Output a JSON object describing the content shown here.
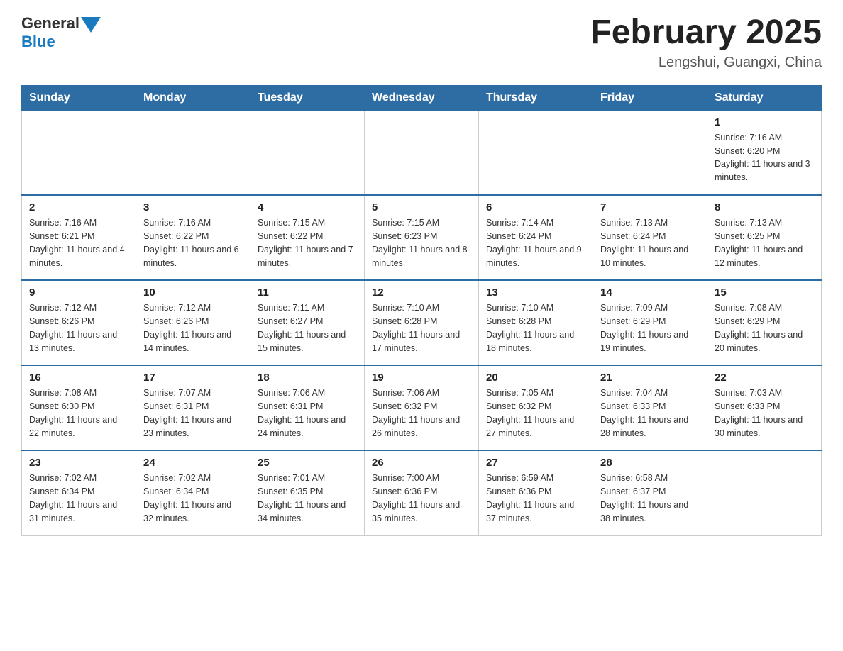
{
  "header": {
    "logo_general": "General",
    "logo_blue": "Blue",
    "title": "February 2025",
    "subtitle": "Lengshui, Guangxi, China"
  },
  "days_of_week": [
    "Sunday",
    "Monday",
    "Tuesday",
    "Wednesday",
    "Thursday",
    "Friday",
    "Saturday"
  ],
  "weeks": [
    {
      "days": [
        {
          "number": "",
          "info": ""
        },
        {
          "number": "",
          "info": ""
        },
        {
          "number": "",
          "info": ""
        },
        {
          "number": "",
          "info": ""
        },
        {
          "number": "",
          "info": ""
        },
        {
          "number": "",
          "info": ""
        },
        {
          "number": "1",
          "info": "Sunrise: 7:16 AM\nSunset: 6:20 PM\nDaylight: 11 hours\nand 3 minutes."
        }
      ]
    },
    {
      "days": [
        {
          "number": "2",
          "info": "Sunrise: 7:16 AM\nSunset: 6:21 PM\nDaylight: 11 hours\nand 4 minutes."
        },
        {
          "number": "3",
          "info": "Sunrise: 7:16 AM\nSunset: 6:22 PM\nDaylight: 11 hours\nand 6 minutes."
        },
        {
          "number": "4",
          "info": "Sunrise: 7:15 AM\nSunset: 6:22 PM\nDaylight: 11 hours\nand 7 minutes."
        },
        {
          "number": "5",
          "info": "Sunrise: 7:15 AM\nSunset: 6:23 PM\nDaylight: 11 hours\nand 8 minutes."
        },
        {
          "number": "6",
          "info": "Sunrise: 7:14 AM\nSunset: 6:24 PM\nDaylight: 11 hours\nand 9 minutes."
        },
        {
          "number": "7",
          "info": "Sunrise: 7:13 AM\nSunset: 6:24 PM\nDaylight: 11 hours\nand 10 minutes."
        },
        {
          "number": "8",
          "info": "Sunrise: 7:13 AM\nSunset: 6:25 PM\nDaylight: 11 hours\nand 12 minutes."
        }
      ]
    },
    {
      "days": [
        {
          "number": "9",
          "info": "Sunrise: 7:12 AM\nSunset: 6:26 PM\nDaylight: 11 hours\nand 13 minutes."
        },
        {
          "number": "10",
          "info": "Sunrise: 7:12 AM\nSunset: 6:26 PM\nDaylight: 11 hours\nand 14 minutes."
        },
        {
          "number": "11",
          "info": "Sunrise: 7:11 AM\nSunset: 6:27 PM\nDaylight: 11 hours\nand 15 minutes."
        },
        {
          "number": "12",
          "info": "Sunrise: 7:10 AM\nSunset: 6:28 PM\nDaylight: 11 hours\nand 17 minutes."
        },
        {
          "number": "13",
          "info": "Sunrise: 7:10 AM\nSunset: 6:28 PM\nDaylight: 11 hours\nand 18 minutes."
        },
        {
          "number": "14",
          "info": "Sunrise: 7:09 AM\nSunset: 6:29 PM\nDaylight: 11 hours\nand 19 minutes."
        },
        {
          "number": "15",
          "info": "Sunrise: 7:08 AM\nSunset: 6:29 PM\nDaylight: 11 hours\nand 20 minutes."
        }
      ]
    },
    {
      "days": [
        {
          "number": "16",
          "info": "Sunrise: 7:08 AM\nSunset: 6:30 PM\nDaylight: 11 hours\nand 22 minutes."
        },
        {
          "number": "17",
          "info": "Sunrise: 7:07 AM\nSunset: 6:31 PM\nDaylight: 11 hours\nand 23 minutes."
        },
        {
          "number": "18",
          "info": "Sunrise: 7:06 AM\nSunset: 6:31 PM\nDaylight: 11 hours\nand 24 minutes."
        },
        {
          "number": "19",
          "info": "Sunrise: 7:06 AM\nSunset: 6:32 PM\nDaylight: 11 hours\nand 26 minutes."
        },
        {
          "number": "20",
          "info": "Sunrise: 7:05 AM\nSunset: 6:32 PM\nDaylight: 11 hours\nand 27 minutes."
        },
        {
          "number": "21",
          "info": "Sunrise: 7:04 AM\nSunset: 6:33 PM\nDaylight: 11 hours\nand 28 minutes."
        },
        {
          "number": "22",
          "info": "Sunrise: 7:03 AM\nSunset: 6:33 PM\nDaylight: 11 hours\nand 30 minutes."
        }
      ]
    },
    {
      "days": [
        {
          "number": "23",
          "info": "Sunrise: 7:02 AM\nSunset: 6:34 PM\nDaylight: 11 hours\nand 31 minutes."
        },
        {
          "number": "24",
          "info": "Sunrise: 7:02 AM\nSunset: 6:34 PM\nDaylight: 11 hours\nand 32 minutes."
        },
        {
          "number": "25",
          "info": "Sunrise: 7:01 AM\nSunset: 6:35 PM\nDaylight: 11 hours\nand 34 minutes."
        },
        {
          "number": "26",
          "info": "Sunrise: 7:00 AM\nSunset: 6:36 PM\nDaylight: 11 hours\nand 35 minutes."
        },
        {
          "number": "27",
          "info": "Sunrise: 6:59 AM\nSunset: 6:36 PM\nDaylight: 11 hours\nand 37 minutes."
        },
        {
          "number": "28",
          "info": "Sunrise: 6:58 AM\nSunset: 6:37 PM\nDaylight: 11 hours\nand 38 minutes."
        },
        {
          "number": "",
          "info": ""
        }
      ]
    }
  ]
}
